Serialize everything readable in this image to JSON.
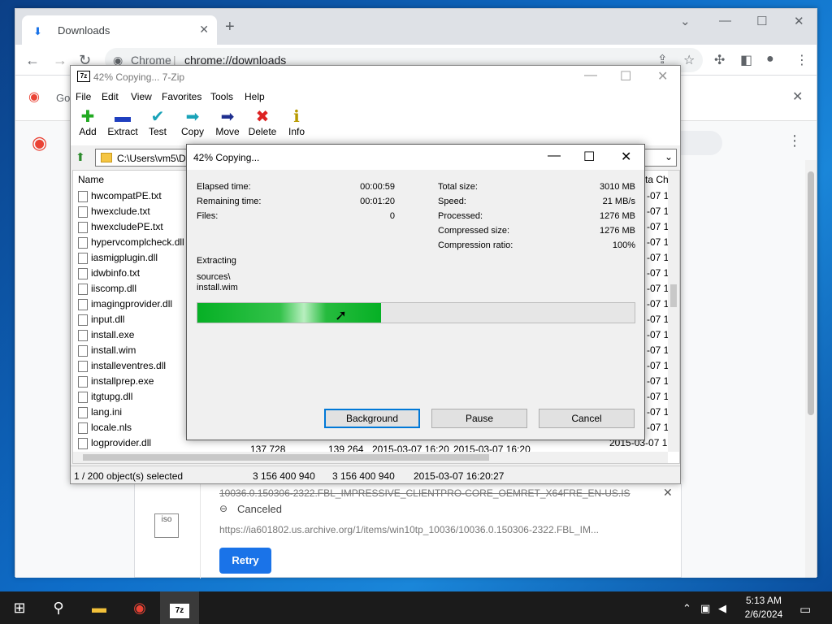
{
  "chrome": {
    "tab_label": "Downloads",
    "new_tab": "+",
    "omni_site": "Chrome",
    "omni_url": "chrome://downloads",
    "bookmark_label": "Go"
  },
  "download_card": {
    "filename": "10036.0.150306-2322.FBL_IMPRESSIVE_CLIENTPRO-CORE_OEMRET_X64FRE_EN-US.IS",
    "status": "Canceled",
    "url": "https://ia601802.us.archive.org/1/items/win10tp_10036/10036.0.150306-2322.FBL_IM...",
    "retry_label": "Retry",
    "file_icon_label": "iso"
  },
  "zip": {
    "title": "42% Copying... 7-Zip",
    "icon_text": "7z",
    "menu": [
      "File",
      "Edit",
      "View",
      "Favorites",
      "Tools",
      "Help"
    ],
    "toolbar": [
      {
        "label": "Add",
        "icon": "plus-icon",
        "glyph": "✚",
        "color": "#22aa22"
      },
      {
        "label": "Extract",
        "icon": "minus-icon",
        "glyph": "▬",
        "color": "#1f3fbf"
      },
      {
        "label": "Test",
        "icon": "check-icon",
        "glyph": "✔",
        "color": "#1aa3b8"
      },
      {
        "label": "Copy",
        "icon": "copy-arrow-icon",
        "glyph": "➡",
        "color": "#1aa3b8"
      },
      {
        "label": "Move",
        "icon": "move-arrow-icon",
        "glyph": "➡",
        "color": "#1f2f8f"
      },
      {
        "label": "Delete",
        "icon": "delete-x-icon",
        "glyph": "✖",
        "color": "#dd2222"
      },
      {
        "label": "Info",
        "icon": "info-icon",
        "glyph": "ℹ",
        "color": "#b89a00"
      }
    ],
    "path": "C:\\Users\\vm5\\D",
    "col_name": "Name",
    "col_right": "ta Ch",
    "files": [
      "hwcompatPE.txt",
      "hwexclude.txt",
      "hwexcludePE.txt",
      "hypervcomplcheck.dll",
      "iasmigplugin.dll",
      "idwbinfo.txt",
      "iiscomp.dll",
      "imagingprovider.dll",
      "input.dll",
      "install.exe",
      "install.wim",
      "installeventres.dll",
      "installprep.exe",
      "itgtupg.dll",
      "lang.ini",
      "locale.nls",
      "logprovider.dll"
    ],
    "right_col": "-07 1",
    "right_col_last": "2015-03-07 1",
    "last_row_extra": [
      "137 728",
      "139 264",
      "2015-03-07 16:20",
      "2015-03-07 16:20"
    ],
    "status": [
      "1 / 200 object(s) selected",
      "3 156 400 940",
      "3 156 400 940",
      "2015-03-07 16:20:27"
    ]
  },
  "dialog": {
    "title": "42% Copying...",
    "elapsed_label": "Elapsed time:",
    "elapsed": "00:00:59",
    "remaining_label": "Remaining time:",
    "remaining": "00:01:20",
    "files_label": "Files:",
    "files": "0",
    "total_label": "Total size:",
    "total": "3010 MB",
    "speed_label": "Speed:",
    "speed": "21 MB/s",
    "processed_label": "Processed:",
    "processed": "1276 MB",
    "compressed_label": "Compressed size:",
    "compressed": "1276 MB",
    "ratio_label": "Compression ratio:",
    "ratio": "100%",
    "operation": "Extracting",
    "path1": "sources\\",
    "path2": "install.wim",
    "progress": 0.42,
    "background_btn": "Background",
    "pause_btn": "Pause",
    "cancel_btn": "Cancel"
  },
  "taskbar": {
    "time": "5:13 AM",
    "date": "2/6/2024"
  }
}
